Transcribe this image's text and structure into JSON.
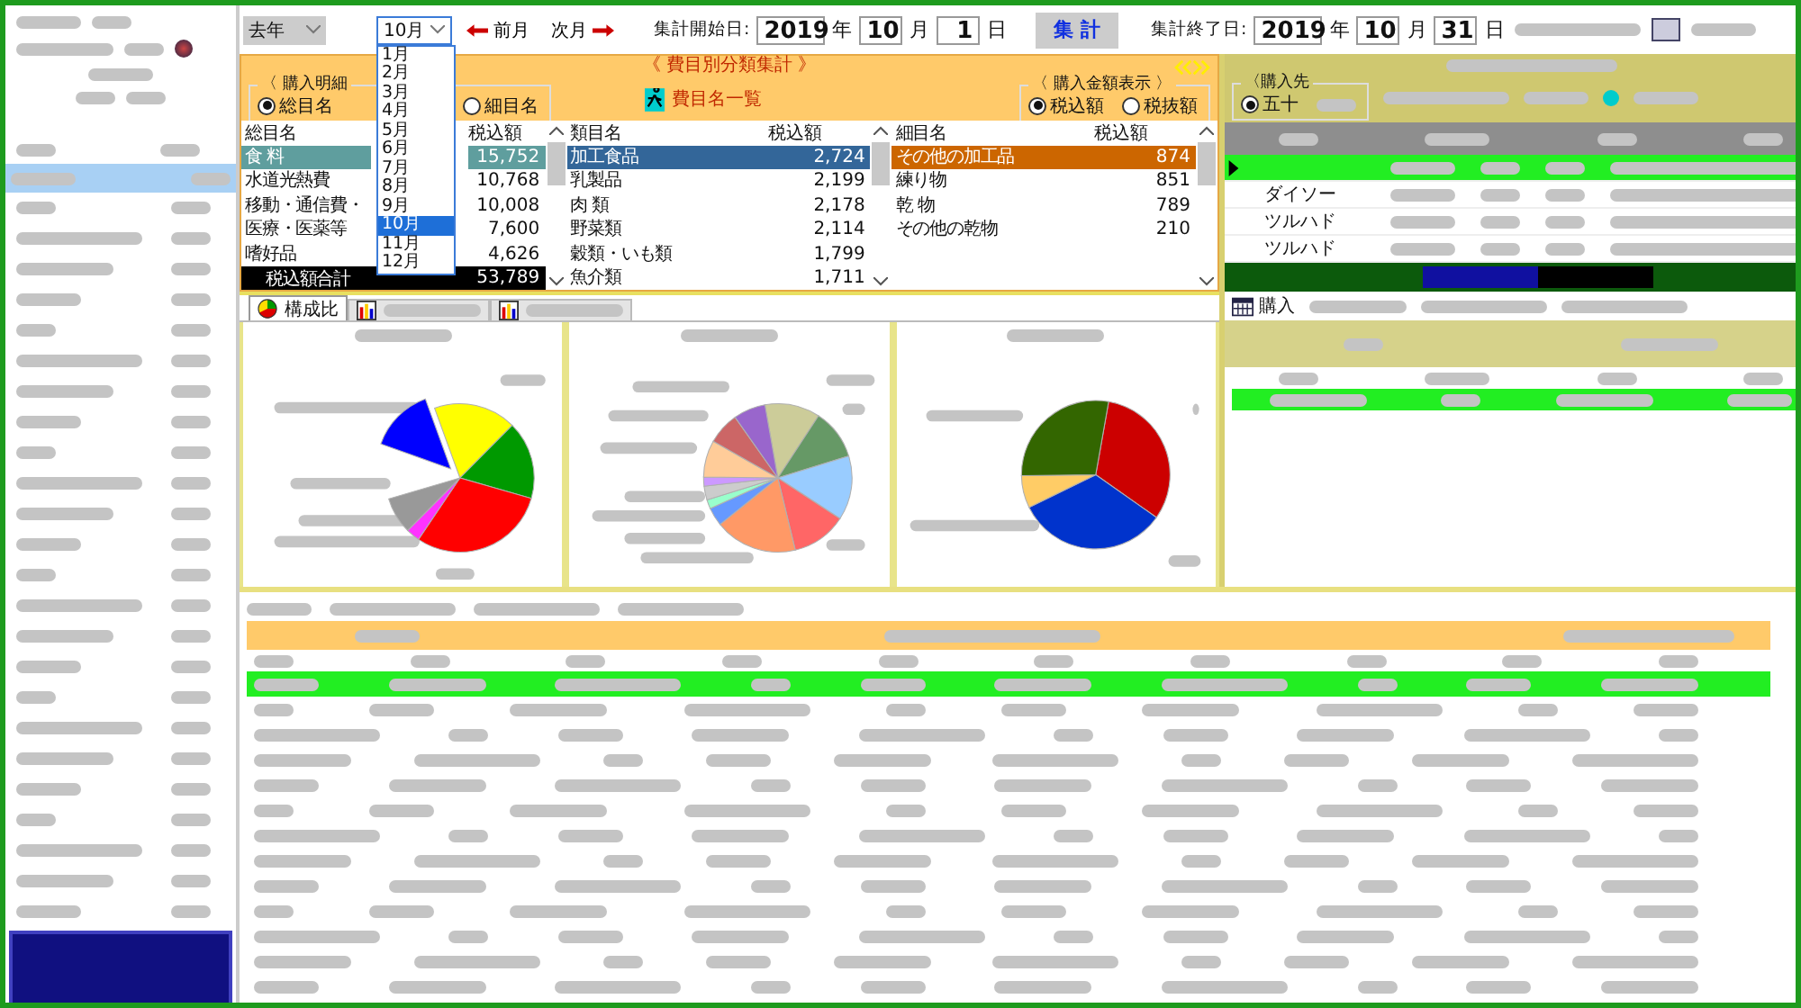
{
  "toolbar": {
    "year_select": "去年",
    "month_select": {
      "value": "10月",
      "expanded": true,
      "options": [
        {
          "label": "1月",
          "selected": false
        },
        {
          "label": "2月",
          "selected": false
        },
        {
          "label": "3月",
          "selected": false
        },
        {
          "label": "4月",
          "selected": false
        },
        {
          "label": "5月",
          "selected": false
        },
        {
          "label": "6月",
          "selected": false
        },
        {
          "label": "7月",
          "selected": false
        },
        {
          "label": "8月",
          "selected": false
        },
        {
          "label": "9月",
          "selected": false
        },
        {
          "label": "10月",
          "selected": true
        },
        {
          "label": "11月",
          "selected": false
        },
        {
          "label": "12月",
          "selected": false
        }
      ]
    },
    "prev_label": "前月",
    "next_label": "次月",
    "start_label": "集計開始日:",
    "start": {
      "year": "2019",
      "year_unit": "年",
      "month": "10",
      "month_unit": "月",
      "day": "1",
      "day_unit": "日"
    },
    "run_button": "集 計",
    "end_label": "集計終了日:",
    "end": {
      "year": "2019",
      "year_unit": "年",
      "month": "10",
      "month_unit": "月",
      "day": "31",
      "day_unit": "日"
    }
  },
  "summary": {
    "title": "《 費目別分類集計 》",
    "detail_group": {
      "legend": "〈 購入明細",
      "options": [
        {
          "label": "総目名",
          "selected": true
        },
        {
          "label": "細目名",
          "selected": false
        }
      ]
    },
    "list_link": "費目名一覧",
    "amount_group": {
      "legend": "〈 購入金額表示 〉",
      "options": [
        {
          "label": "税込額",
          "selected": true
        },
        {
          "label": "税抜額",
          "selected": false
        }
      ]
    },
    "tables": [
      {
        "columns": [
          "総目名",
          "税込額"
        ],
        "rows": [
          {
            "name": "食 料",
            "amount": "15,752",
            "selected": true
          },
          {
            "name": "水道光熱費",
            "amount": "10,768",
            "selected": false
          },
          {
            "name": "移動・通信費・",
            "amount": "10,008",
            "selected": false
          },
          {
            "name": "医療・医薬等",
            "amount": "7,600",
            "selected": false
          },
          {
            "name": "嗜好品",
            "amount": "4,626",
            "selected": false
          }
        ],
        "total": {
          "label": "税込額合計",
          "amount": "53,789"
        }
      },
      {
        "columns": [
          "類目名",
          "税込額"
        ],
        "rows": [
          {
            "name": "加工食品",
            "amount": "2,724",
            "selected": true
          },
          {
            "name": "乳製品",
            "amount": "2,199",
            "selected": false
          },
          {
            "name": "肉 類",
            "amount": "2,178",
            "selected": false
          },
          {
            "name": "野菜類",
            "amount": "2,114",
            "selected": false
          },
          {
            "name": "穀類・いも類",
            "amount": "1,799",
            "selected": false
          },
          {
            "name": "魚介類",
            "amount": "1,711",
            "selected": false
          }
        ]
      },
      {
        "columns": [
          "細目名",
          "税込額"
        ],
        "rows": [
          {
            "name": "その他の加工品",
            "amount": "874",
            "selected": true
          },
          {
            "name": "練り物",
            "amount": "851",
            "selected": false
          },
          {
            "name": "乾 物",
            "amount": "789",
            "selected": false
          },
          {
            "name": "その他の乾物",
            "amount": "210",
            "selected": false
          }
        ]
      }
    ]
  },
  "chart_tabs": [
    {
      "label": "構成比",
      "selected": true
    },
    {
      "selected": false
    },
    {
      "selected": false
    }
  ],
  "vendors": {
    "legend": "〈購入先",
    "sort_option": {
      "label": "五十",
      "selected": true
    },
    "rows": [
      {
        "selected": true
      },
      {
        "name": "ダイソー",
        "selected": false
      },
      {
        "name": "ツルハド",
        "selected": false
      },
      {
        "name": "ツルハド",
        "selected": false
      }
    ]
  },
  "purchase_tab": "購入"
}
